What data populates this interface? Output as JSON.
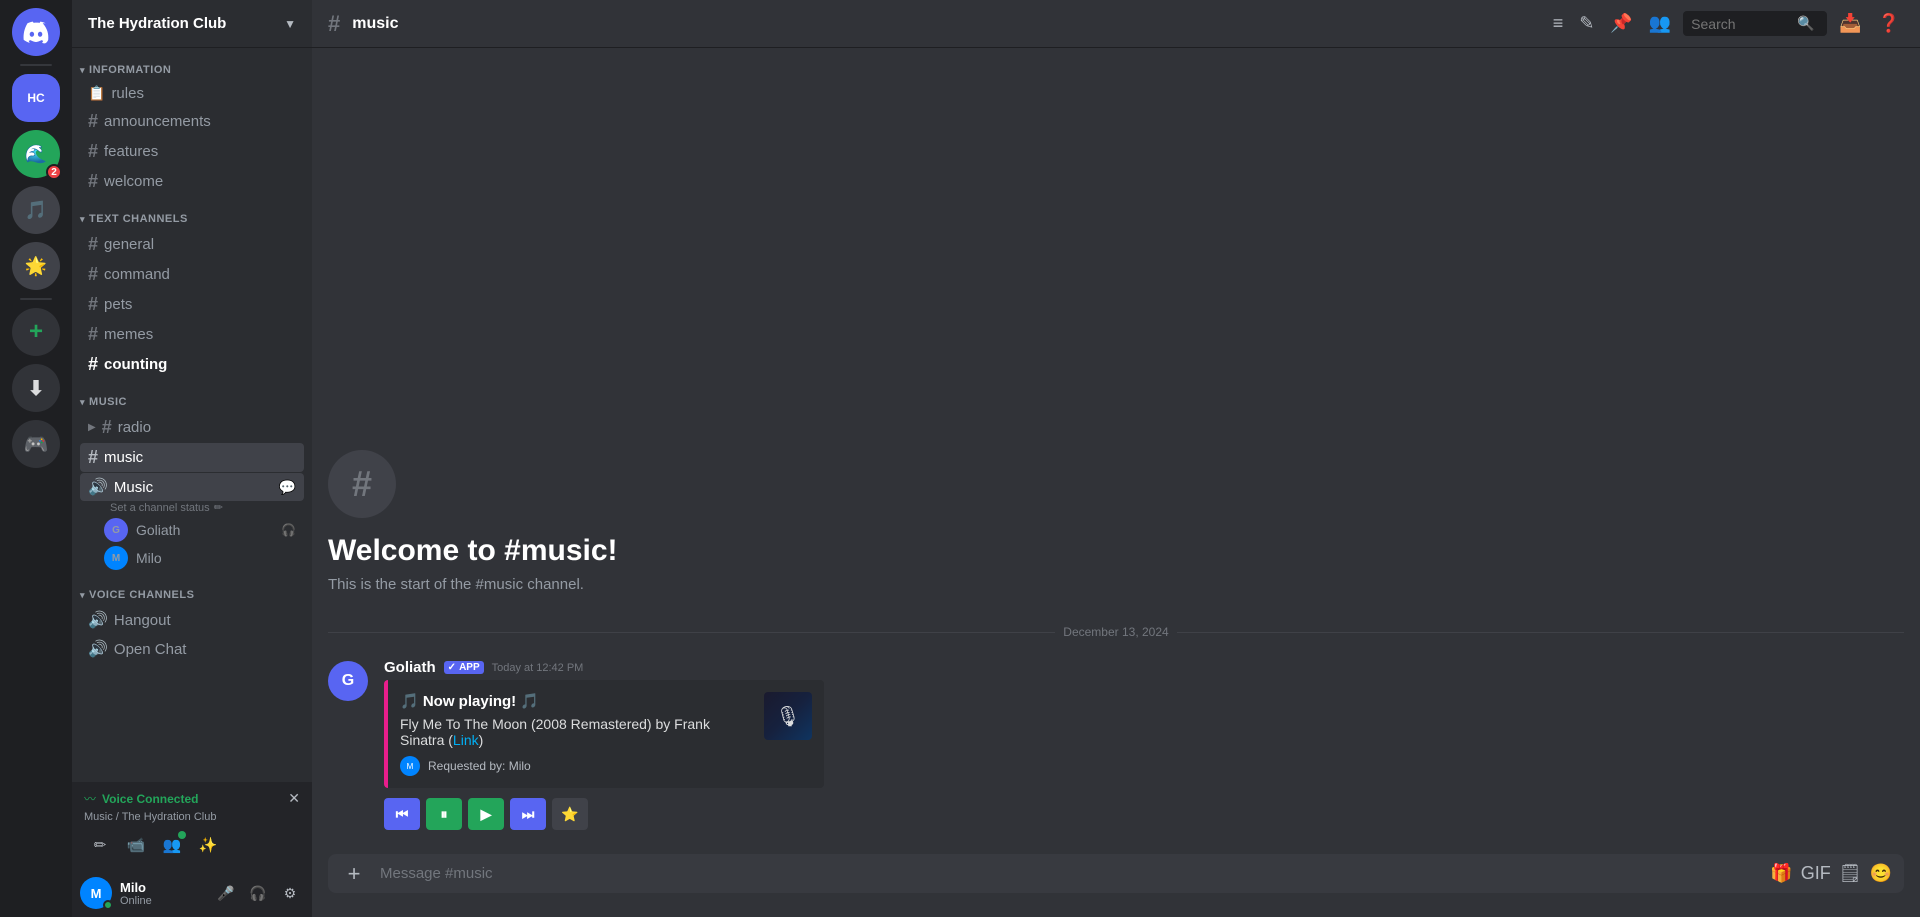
{
  "server": {
    "name": "The Hydration Club",
    "icon_letter": "H"
  },
  "sidebar": {
    "header": "The Hydration Club",
    "categories": [
      {
        "name": "INFORMATION",
        "channels": [
          {
            "name": "rules",
            "type": "rules"
          },
          {
            "name": "announcements",
            "type": "hash"
          },
          {
            "name": "features",
            "type": "hash"
          },
          {
            "name": "welcome",
            "type": "hash"
          }
        ]
      },
      {
        "name": "TEXT CHANNELS",
        "channels": [
          {
            "name": "general",
            "type": "hash"
          },
          {
            "name": "command",
            "type": "hash"
          },
          {
            "name": "pets",
            "type": "hash"
          },
          {
            "name": "memes",
            "type": "hash"
          },
          {
            "name": "counting",
            "type": "hash",
            "bold": true
          }
        ]
      }
    ],
    "music": {
      "category": "MUSIC",
      "channels": [
        {
          "name": "radio",
          "type": "hash"
        },
        {
          "name": "music",
          "type": "hash",
          "active": true
        }
      ],
      "voice": {
        "name": "Music",
        "status": "Set a channel status",
        "members": [
          {
            "name": "Goliath",
            "color": "purple"
          },
          {
            "name": "Milo",
            "color": "blue"
          }
        ]
      }
    },
    "voice_channels": {
      "category": "VOICE CHANNELS",
      "channels": [
        {
          "name": "Hangout"
        },
        {
          "name": "Open Chat"
        }
      ]
    }
  },
  "voice_connected": {
    "label": "Voice Connected",
    "channel": "Music / The Hydration Club"
  },
  "user": {
    "name": "Milo",
    "status": "Online"
  },
  "topbar": {
    "channel": "music",
    "search_placeholder": "Search"
  },
  "chat": {
    "welcome_title": "Welcome to #music!",
    "welcome_desc": "This is the start of the #music channel.",
    "date_divider": "December 13, 2024",
    "message": {
      "author": "Goliath",
      "badge": "✓ APP",
      "timestamp": "Today at 12:42 PM",
      "embed_title": "🎵 Now playing! 🎵",
      "embed_desc_prefix": "Fly Me To The Moon (2008 Remastered) by Frank Sinatra (",
      "embed_desc_link": "Link",
      "embed_desc_suffix": ")",
      "embed_footer": "Requested by: Milo"
    }
  },
  "message_input": {
    "placeholder": "Message #music"
  },
  "icons": {
    "threads": "🧵",
    "pencil": "✏️",
    "pin": "📌",
    "members": "👥",
    "search": "🔍",
    "inbox": "📥",
    "help": "❓"
  }
}
